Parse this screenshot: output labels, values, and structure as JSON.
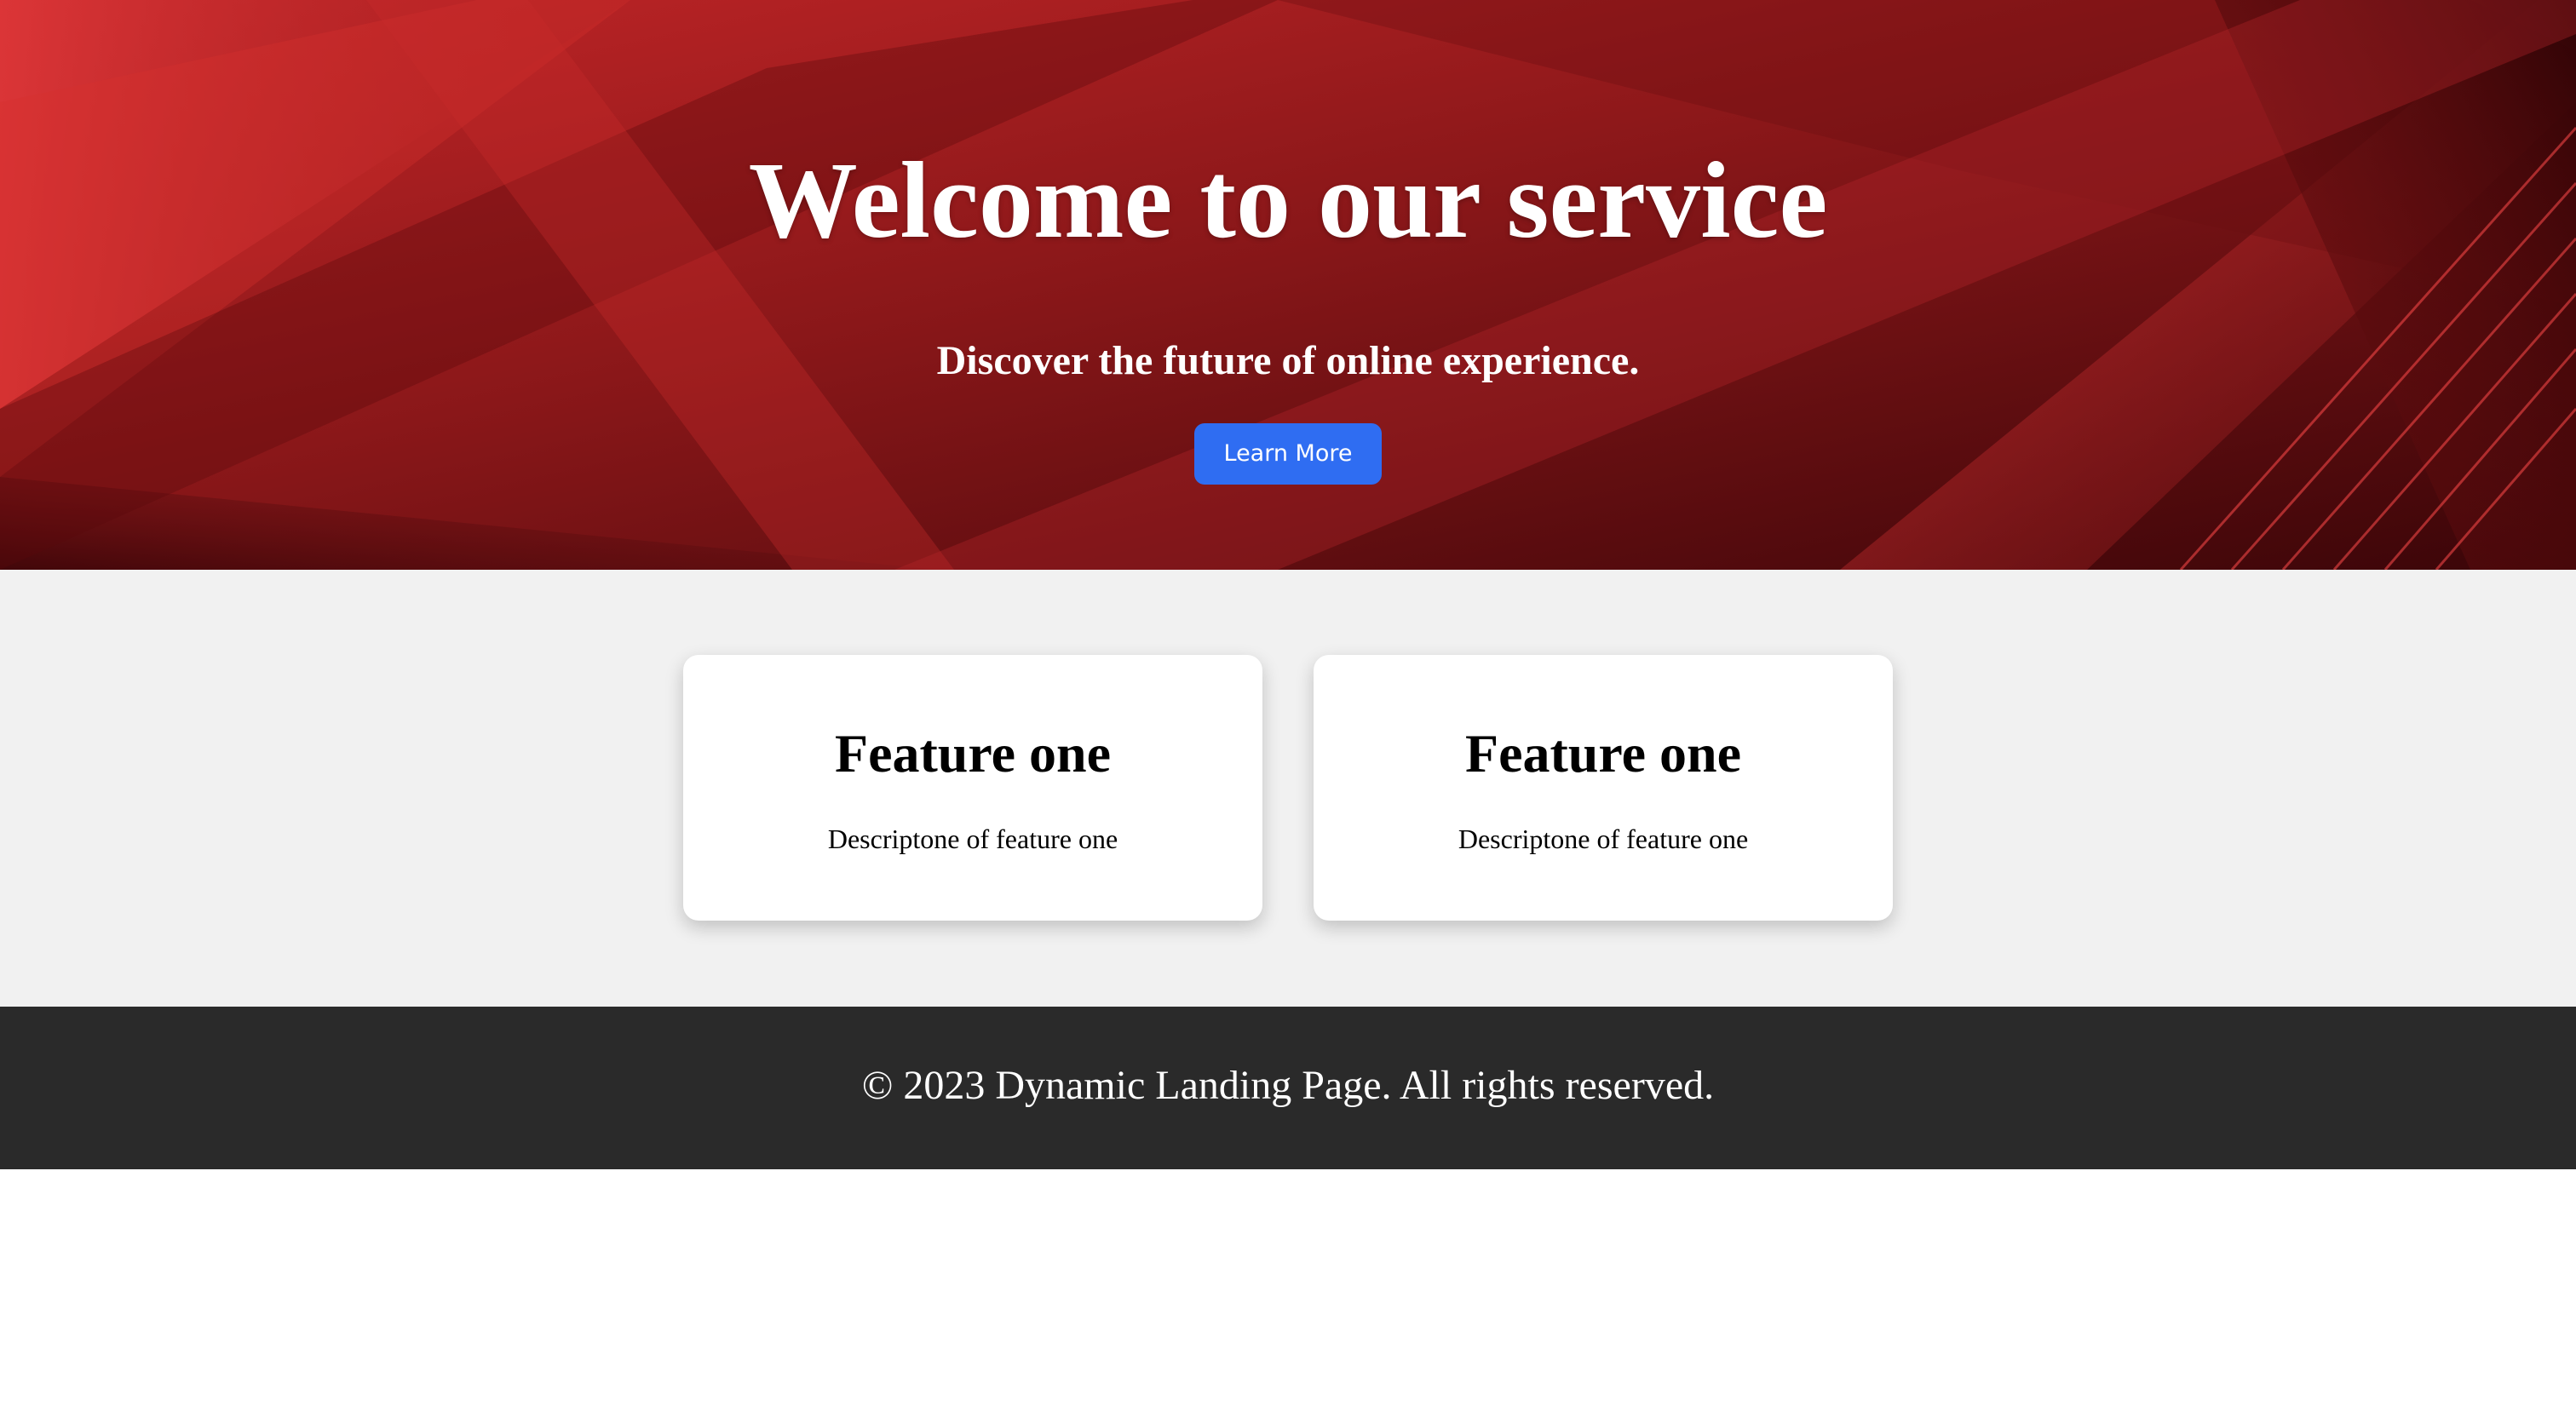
{
  "hero": {
    "title": "Welcome to our service",
    "subtitle": "Discover the future of online experience.",
    "button_label": "Learn More",
    "background_colors": [
      "#3a0508",
      "#7a1416",
      "#c8272a",
      "#e0383a"
    ]
  },
  "features": {
    "cards": [
      {
        "title": "Feature one",
        "description": "Descriptone of feature one"
      },
      {
        "title": "Feature one",
        "description": "Descriptone of feature one"
      }
    ]
  },
  "footer": {
    "text": "© 2023 Dynamic Landing Page. All rights reserved."
  },
  "colors": {
    "accent_button": "#2f6df2",
    "features_bg": "#f1f1f1",
    "footer_bg": "#2a2a2a"
  }
}
